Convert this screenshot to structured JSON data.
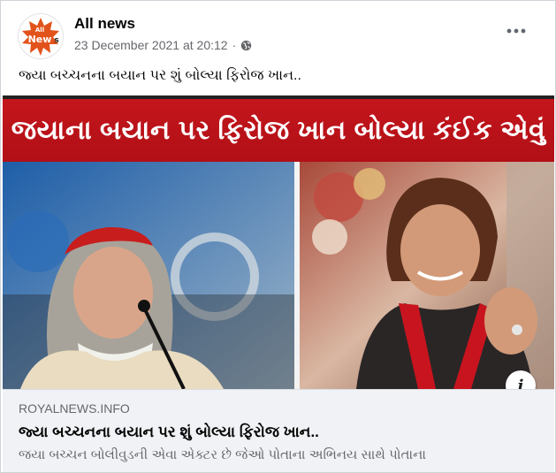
{
  "post": {
    "page_name": "All news",
    "avatar_text": "All News",
    "timestamp": "23 December 2021 at 20:12",
    "separator": "·",
    "privacy_icon": "globe-icon",
    "more_icon": "more-horizontal-icon",
    "text": "જ્યા બચ્ચનના બયાન પર શું બોલ્યા ફિરોજ ખાન.."
  },
  "link_preview": {
    "banner_text": "જયાના બયાન પર ફિરોજ ખાન બોલ્યા કંઈક એવું",
    "info_icon": "i",
    "domain": "ROYALNEWS.INFO",
    "title": "જ્યા બચ્ચનના બયાન પર શું બોલ્યા ફિરોજ ખાન..",
    "description": "જયા બચ્ચન બોલીવુડની એવા એક્ટર છે જેઓ પોતાના અભિનય સાથે પોતાના"
  },
  "colors": {
    "banner_red": "#c4161c",
    "text_primary": "#050505",
    "text_secondary": "#65676b",
    "footer_bg": "#f0f2f5"
  }
}
